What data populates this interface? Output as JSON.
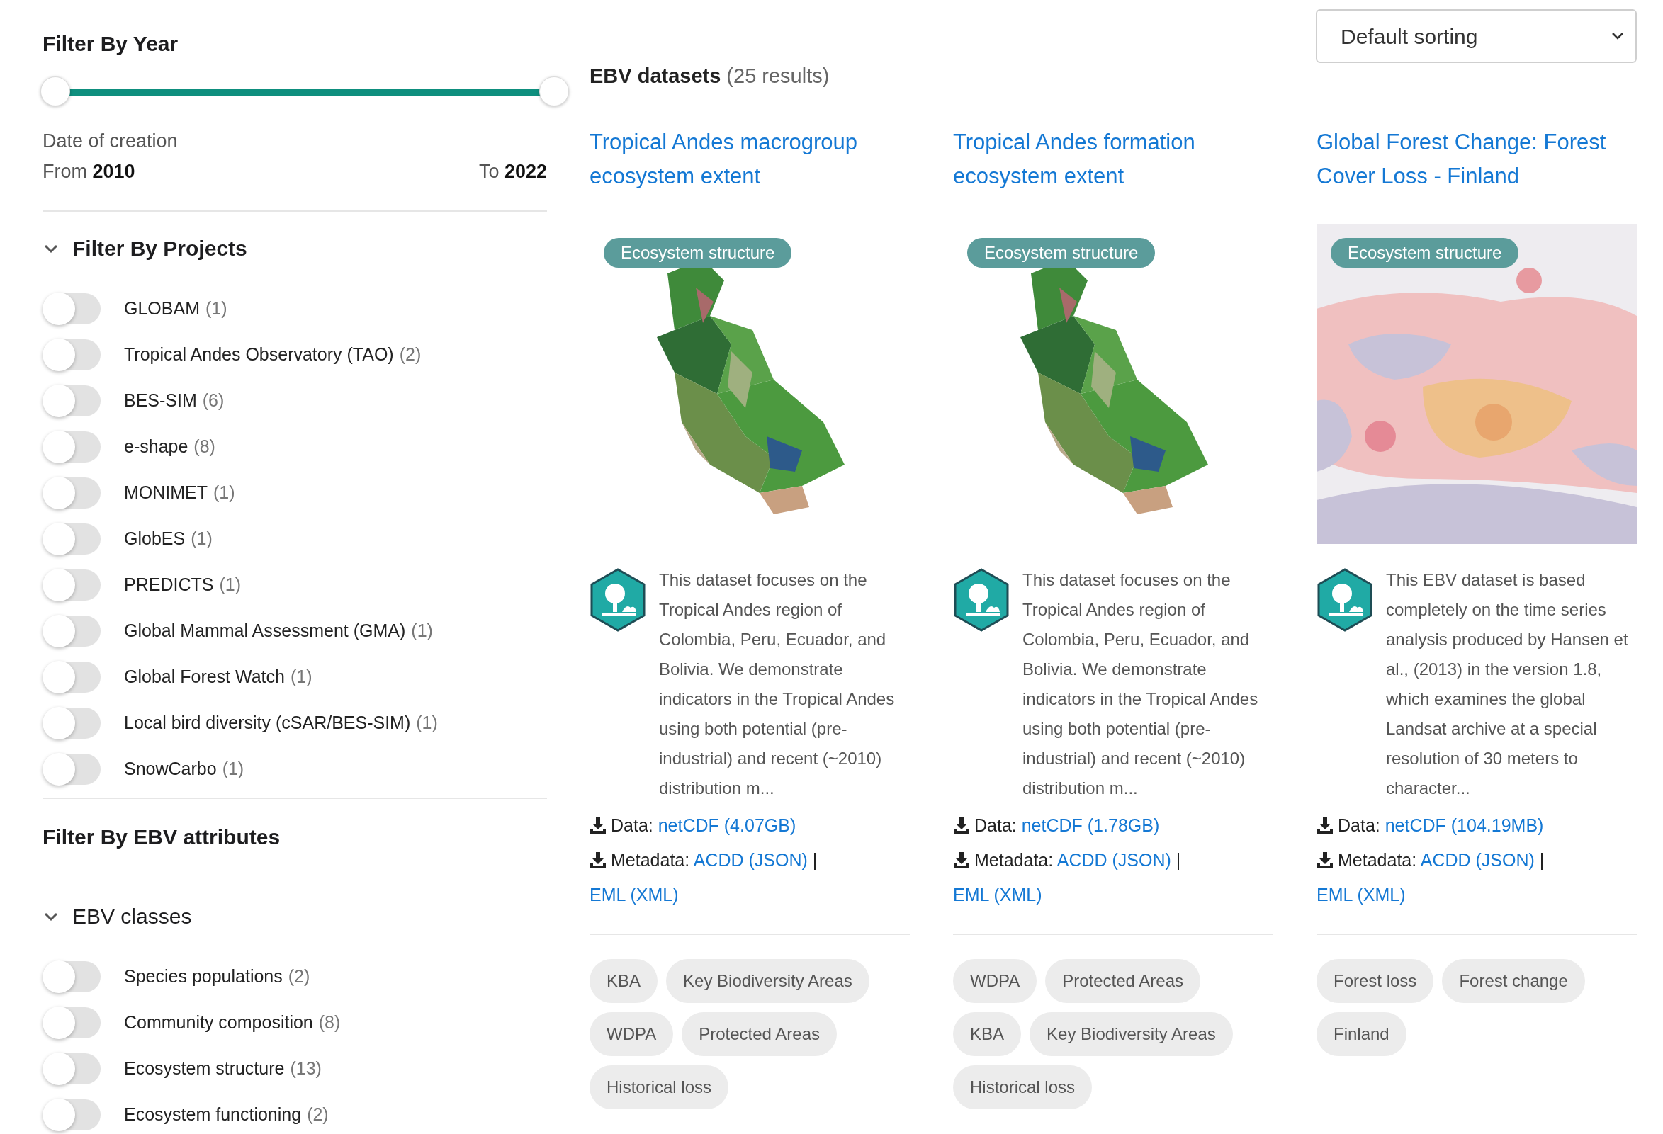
{
  "sidebar": {
    "year_filter": {
      "title": "Filter By Year",
      "handles": [
        {
          "level": 0
        },
        {
          "level": 1
        }
      ],
      "caption": "Date of creation",
      "from_label": "From",
      "from_value": "2010",
      "to_label": "To",
      "to_value": "2022"
    },
    "projects": {
      "title": "Filter By Projects",
      "expanded": true,
      "items": [
        {
          "label": "GLOBAM",
          "count": "(1)",
          "on": false
        },
        {
          "label": "Tropical Andes Observatory (TAO)",
          "count": "(2)",
          "on": false
        },
        {
          "label": "BES-SIM",
          "count": "(6)",
          "on": false
        },
        {
          "label": "e-shape",
          "count": "(8)",
          "on": false
        },
        {
          "label": "MONIMET",
          "count": "(1)",
          "on": false
        },
        {
          "label": "GlobES",
          "count": "(1)",
          "on": false
        },
        {
          "label": "PREDICTS",
          "count": "(1)",
          "on": false
        },
        {
          "label": "Global Mammal Assessment (GMA)",
          "count": "(1)",
          "on": false
        },
        {
          "label": "Global Forest Watch",
          "count": "(1)",
          "on": false
        },
        {
          "label": "Local bird diversity (cSAR/BES-SIM)",
          "count": "(1)",
          "on": false
        },
        {
          "label": "SnowCarbo",
          "count": "(1)",
          "on": false
        }
      ]
    },
    "attributes_title": "Filter By EBV attributes",
    "classes": {
      "title": "EBV classes",
      "expanded": true,
      "items": [
        {
          "label": "Species populations",
          "count": "(2)",
          "on": false
        },
        {
          "label": "Community composition",
          "count": "(8)",
          "on": false
        },
        {
          "label": "Ecosystem structure",
          "count": "(13)",
          "on": false
        },
        {
          "label": "Ecosystem functioning",
          "count": "(2)",
          "on": false
        }
      ]
    }
  },
  "results": {
    "heading": "EBV datasets",
    "count": "(25 results)",
    "sorting": "Default sorting"
  },
  "cards": [
    {
      "title": "Tropical Andes macrogroup ecosystem extent",
      "badge": "Ecosystem structure",
      "description": "This dataset focuses on the Tropical Andes region of Colombia, Peru, Ecuador, and Bolivia. We demonstrate indicators in the Tropical Andes using both potential (pre-industrial) and recent (~2010) distribution m...",
      "data_label": "Data:",
      "data_link": "netCDF (4.07GB)",
      "metadata_label": "Metadata:",
      "metadata_links": [
        "ACDD (JSON)",
        "EML (XML)"
      ],
      "separator": "|",
      "tags": [
        "KBA",
        "Key Biodiversity Areas",
        "WDPA",
        "Protected Areas",
        "Historical loss"
      ]
    },
    {
      "title": "Tropical Andes formation ecosystem extent",
      "badge": "Ecosystem structure",
      "description": "This dataset focuses on the Tropical Andes region of Colombia, Peru, Ecuador, and Bolivia. We demonstrate indicators in the Tropical Andes using both potential (pre-industrial) and recent (~2010) distribution m...",
      "data_label": "Data:",
      "data_link": "netCDF (1.78GB)",
      "metadata_label": "Metadata:",
      "metadata_links": [
        "ACDD (JSON)",
        "EML (XML)"
      ],
      "separator": "|",
      "tags": [
        "WDPA",
        "Protected Areas",
        "KBA",
        "Key Biodiversity Areas",
        "Historical loss"
      ]
    },
    {
      "title": "Global Forest Change: Forest Cover Loss - Finland",
      "badge": "Ecosystem structure",
      "description": "This EBV dataset is based completely on the time series analysis produced by Hansen et al., (2013) in the version 1.8, which examines the global Landsat archive at a special resolution of 30 meters to character...",
      "data_label": "Data:",
      "data_link": "netCDF (104.19MB)",
      "metadata_label": "Metadata:",
      "metadata_links": [
        "ACDD (JSON)",
        "EML (XML)"
      ],
      "separator": "|",
      "tags": [
        "Forest loss",
        "Forest change",
        "Finland"
      ]
    }
  ]
}
